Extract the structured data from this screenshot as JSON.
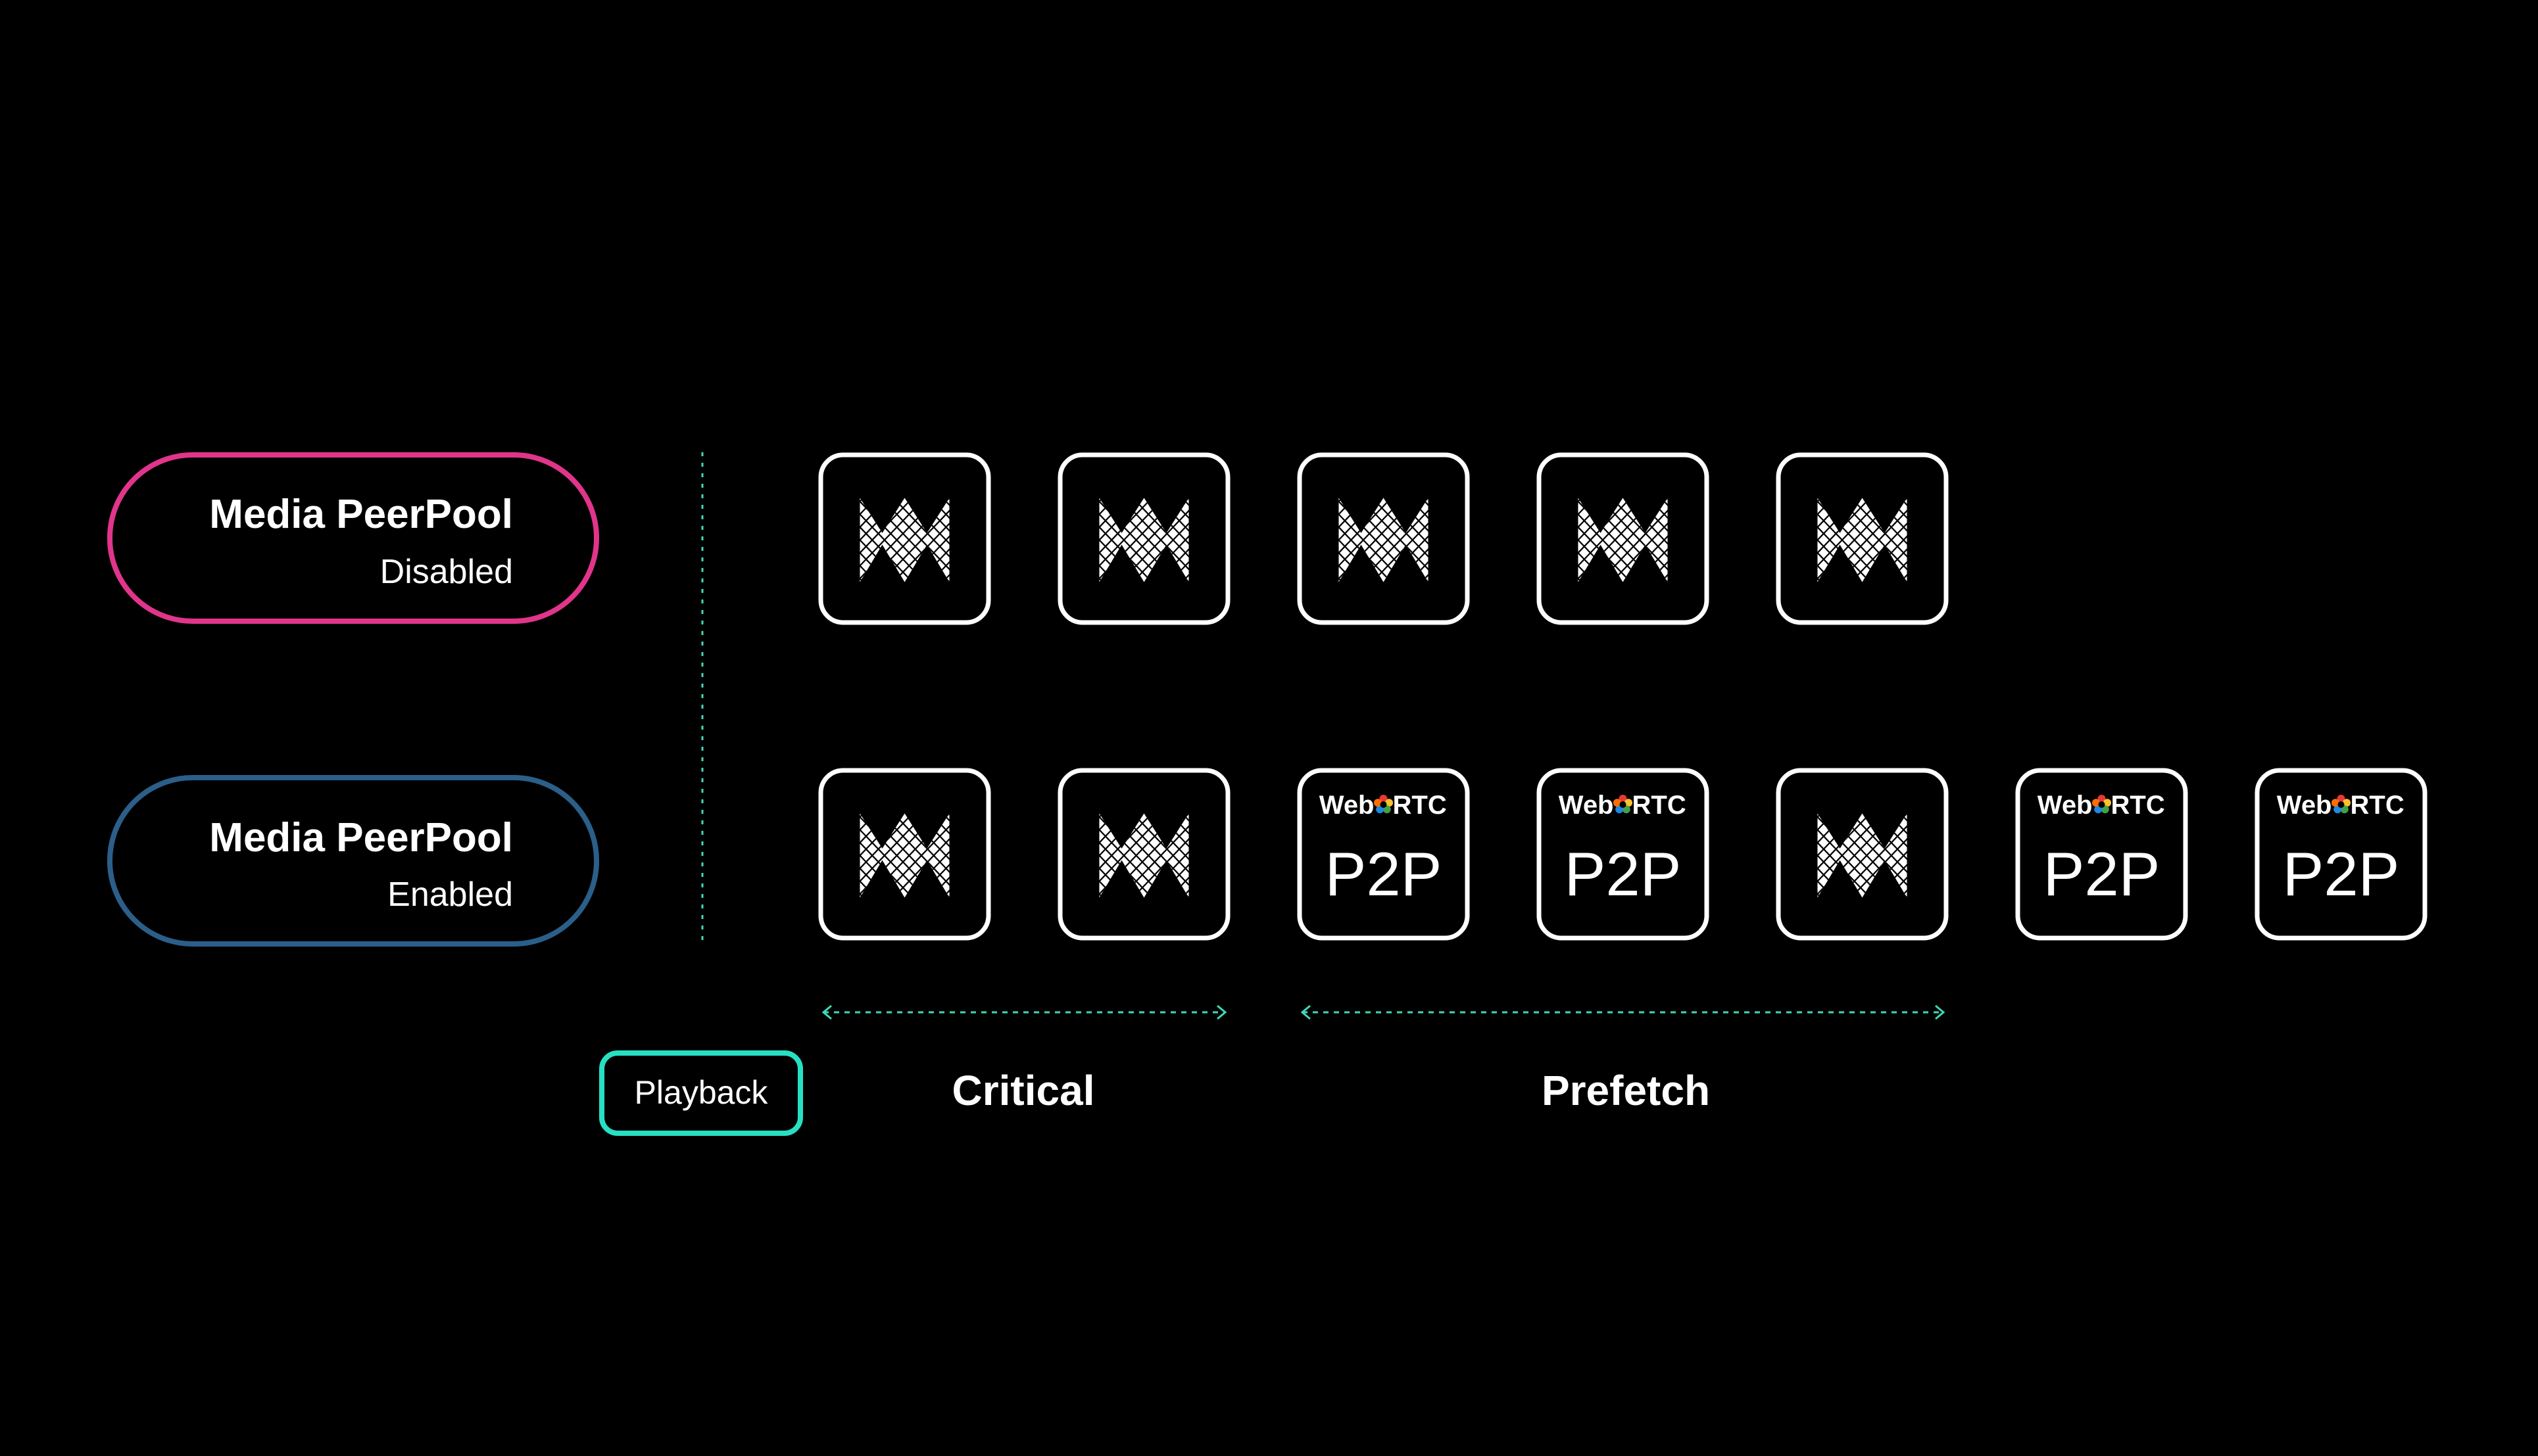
{
  "colors": {
    "background": "#000000",
    "disabled_accent": "#e0358a",
    "enabled_accent": "#2b5f8a",
    "playback_accent": "#27e0c4",
    "guide_line": "#3fd9b8",
    "tile_border": "#ffffff",
    "text": "#ffffff",
    "webrtc_ring": [
      "#e53935",
      "#fbc02d",
      "#43a047",
      "#1e88e5",
      "#ff6d00"
    ]
  },
  "modes": [
    {
      "title": "Media PeerPool",
      "status": "Disabled"
    },
    {
      "title": "Media PeerPool",
      "status": "Enabled"
    }
  ],
  "rows": [
    {
      "mode": "Disabled",
      "tiles": [
        "cdn",
        "cdn",
        "cdn",
        "cdn",
        "cdn"
      ]
    },
    {
      "mode": "Enabled",
      "tiles": [
        "cdn",
        "cdn",
        "p2p",
        "p2p",
        "cdn",
        "p2p",
        "p2p"
      ]
    }
  ],
  "p2p_tile": {
    "brand_left": "Web",
    "brand_right": "RTC",
    "label": "P2P",
    "icon": "webrtc-ring-icon"
  },
  "cdn_tile": {
    "icon": "m-lattice-logo-icon"
  },
  "playback_label": "Playback",
  "segments": [
    {
      "label": "Critical"
    },
    {
      "label": "Prefetch"
    }
  ]
}
